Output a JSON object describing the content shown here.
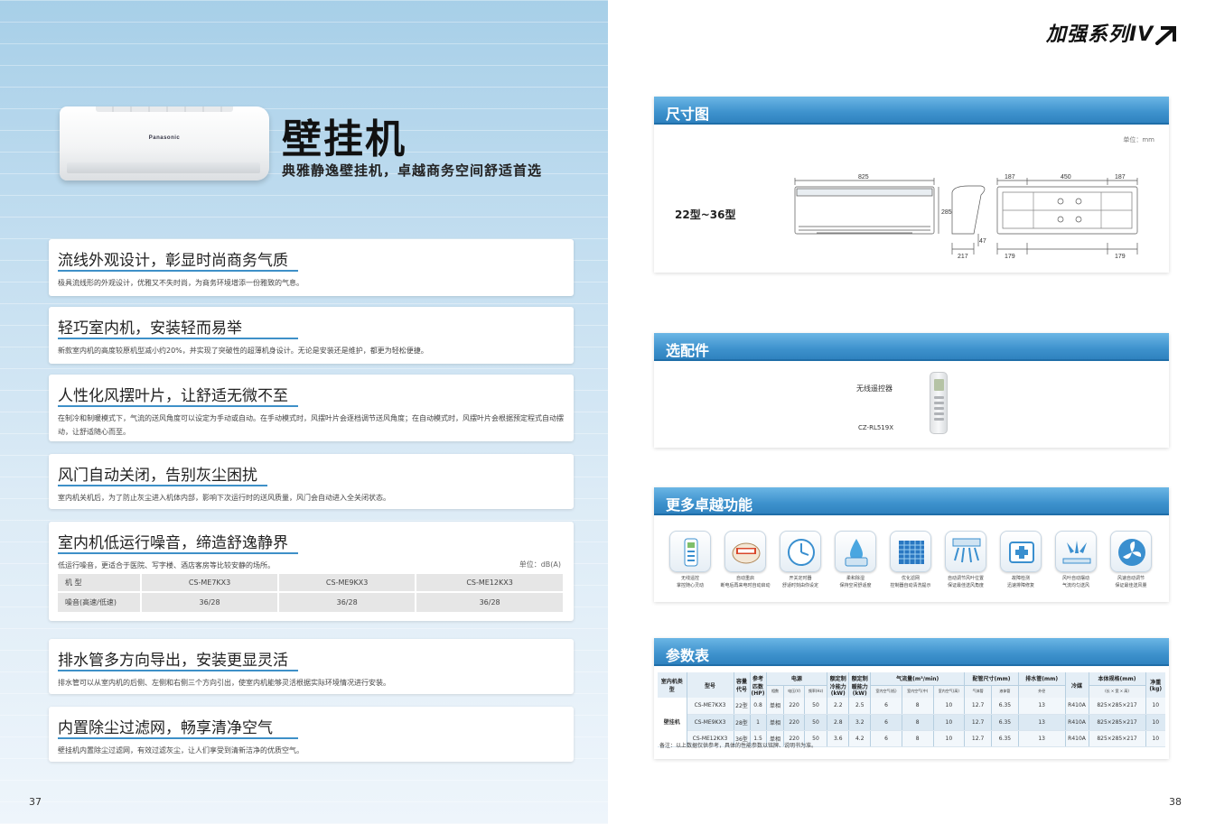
{
  "left": {
    "brand": "Panasonic",
    "title": "壁挂机",
    "subtitle": "典雅静逸壁挂机，卓越商务空间舒适首选",
    "features": [
      {
        "title": "流线外观设计，彰显时尚商务气质",
        "desc": "极具流线形的外观设计，优雅又不失时尚，为商务环境增添一份雅致的气息。"
      },
      {
        "title": "轻巧室内机，安装轻而易举",
        "desc": "新款室内机的高度较原机型减小约20%，并实现了突破性的超薄机身设计。无论是安装还是维护，都更为轻松便捷。"
      },
      {
        "title": "人性化风摆叶片，让舒适无微不至",
        "desc": "在制冷和制暖模式下，气流的送风角度可以设定为手动或自动。在手动模式时，风摆叶片会逐档调节送风角度；在自动模式时，风摆叶片会根据预定程式自动摆动，让舒适随心而至。"
      },
      {
        "title": "风门自动关闭，告别灰尘困扰",
        "desc": "室内机关机后，为了防止灰尘进入机体内部，影响下次运行时的送风质量，风门会自动进入全关闭状态。"
      },
      {
        "title": "室内机低运行噪音，缔造舒逸静界",
        "desc": "低运行噪音，更适合于医院、写字楼、酒店客房等比较安静的场所。",
        "unit": "单位：dB(A)",
        "table": {
          "header": [
            "机 型",
            "CS-ME7KX3",
            "CS-ME9KX3",
            "CS-ME12KX3"
          ],
          "row": [
            "噪音(高速/低速)",
            "36/28",
            "36/28",
            "36/28"
          ]
        }
      },
      {
        "title": "排水管多方向导出，安装更显灵活",
        "desc": "排水管可以从室内机的后侧、左侧和右侧三个方向引出，使室内机能够灵活根据实际环境情况进行安装。"
      },
      {
        "title": "内置除尘过滤网，畅享清净空气",
        "desc": "壁挂机内置除尘过滤网，有效过滤灰尘，让人们享受到清新洁净的优质空气。"
      }
    ],
    "page_number": "37"
  },
  "right": {
    "series_title": "加强系列IV",
    "dimension": {
      "heading": "尺寸图",
      "unit": "单位：mm",
      "model_range": "22型~36型",
      "dims": {
        "width": "825",
        "height": "285",
        "depth": "217",
        "small": "47",
        "left_w": "179",
        "right_w": "179",
        "top_l": "187",
        "top_m": "450",
        "top_r": "187"
      }
    },
    "accessory": {
      "heading": "选配件",
      "name": "无线遥控器",
      "model": "CZ-RL519X"
    },
    "functions": {
      "heading": "更多卓越功能",
      "items": [
        {
          "icon": "remote-icon",
          "label": "无线遥控\n掌控随心灵动"
        },
        {
          "icon": "restart-icon",
          "label": "自动重启\n断电后再来电时自动启动"
        },
        {
          "icon": "timer-icon",
          "label": "开关定时器\n舒适时刻由你设定"
        },
        {
          "icon": "dehumidify-icon",
          "label": "柔和除湿\n保持空间舒适度"
        },
        {
          "icon": "filter-icon",
          "label": "优化滤网\n控制器自动清洗提示"
        },
        {
          "icon": "airflow-icon",
          "label": "自动调节风叶位置\n保证最佳送风角度"
        },
        {
          "icon": "diagnosis-icon",
          "label": "故障检测\n迅速排障修复"
        },
        {
          "icon": "auto-airflow-icon",
          "label": "风叶自动摆动\n气流均匀送风"
        },
        {
          "icon": "fan-icon",
          "label": "风速自动调节\n保证最佳送风量"
        }
      ]
    },
    "params": {
      "heading": "参数表",
      "headers": {
        "type": "室内机类型",
        "model": "型号",
        "capacity": "容量代号",
        "hp": "参考匹数(HP)",
        "power": "电源",
        "phase": "相数",
        "voltage": "电压(V)",
        "freq": "频率(Hz)",
        "cool": "额定制冷能力(kW)",
        "heat": "额定制暖能力(kW)",
        "airflow": "气流量(m³/min)",
        "air1": "室内空气(低)",
        "air2": "室内空气(中)",
        "air3": "室内空气(高)",
        "pipe": "配管尺寸(mm)",
        "gas": "气体管",
        "liquid": "液体管",
        "drain": "排水管(mm)",
        "drain_sub": "外径",
        "refrigerant": "冷媒",
        "size": "本体规格(mm)",
        "size_sub": "(长 × 宽 × 高)",
        "weight": "净重(kg)"
      },
      "type_value": "壁挂机",
      "rows": [
        {
          "model": "CS-ME7KX3",
          "capacity": "22型",
          "hp": "0.8",
          "phase": "单相",
          "voltage": "220",
          "freq": "50",
          "cool": "2.2",
          "heat": "2.5",
          "air1": "6",
          "air2": "8",
          "air3": "10",
          "gas": "12.7",
          "liquid": "6.35",
          "drain": "13",
          "refrigerant": "R410A",
          "size": "825×285×217",
          "weight": "10"
        },
        {
          "model": "CS-ME9KX3",
          "capacity": "28型",
          "hp": "1",
          "phase": "单相",
          "voltage": "220",
          "freq": "50",
          "cool": "2.8",
          "heat": "3.2",
          "air1": "6",
          "air2": "8",
          "air3": "10",
          "gas": "12.7",
          "liquid": "6.35",
          "drain": "13",
          "refrigerant": "R410A",
          "size": "825×285×217",
          "weight": "10"
        },
        {
          "model": "CS-ME12KX3",
          "capacity": "36型",
          "hp": "1.5",
          "phase": "单相",
          "voltage": "220",
          "freq": "50",
          "cool": "3.6",
          "heat": "4.2",
          "air1": "6",
          "air2": "8",
          "air3": "10",
          "gas": "12.7",
          "liquid": "6.35",
          "drain": "13",
          "refrigerant": "R410A",
          "size": "825×285×217",
          "weight": "10"
        }
      ],
      "note": "备注：以上数据仅供参考，具体的性能参数以铭牌、说明书为准。"
    },
    "page_number": "38"
  }
}
